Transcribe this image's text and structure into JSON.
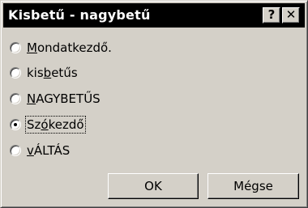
{
  "window": {
    "title": "Kisbetű - nagybetű",
    "help_label": "?",
    "close_label": "✕"
  },
  "options": [
    {
      "before": "",
      "accel": "M",
      "after": "ondatkezdő.",
      "checked": false
    },
    {
      "before": "kis",
      "accel": "b",
      "after": "etűs",
      "checked": false
    },
    {
      "before": "",
      "accel": "N",
      "after": "AGYBETŰS",
      "checked": false
    },
    {
      "before": "Sz",
      "accel": "ó",
      "after": "kezdő",
      "checked": true
    },
    {
      "before": "",
      "accel": "v",
      "after": "ÁLTÁS",
      "checked": false
    }
  ],
  "buttons": {
    "ok_label": "OK",
    "cancel_label": "Mégse"
  }
}
